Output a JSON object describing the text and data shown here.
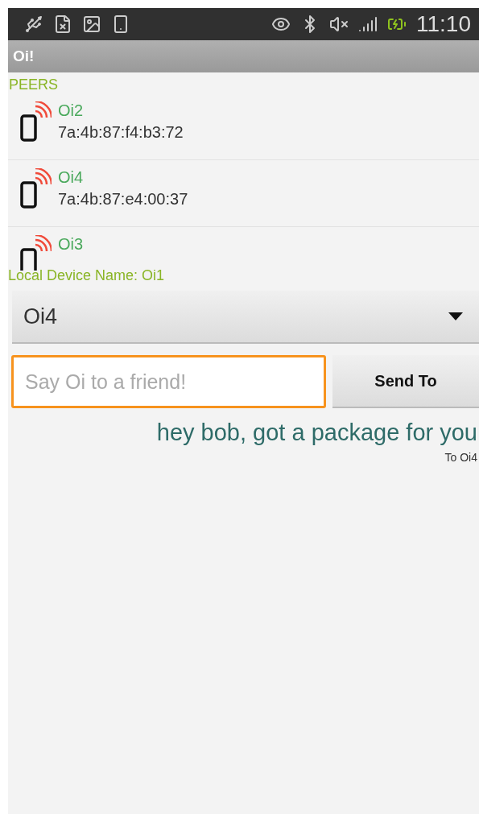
{
  "status_bar": {
    "time": "11:10"
  },
  "app_bar": {
    "title": "Oi!"
  },
  "peers_header": "PEERS",
  "peers": [
    {
      "name": "Oi2",
      "address": "7a:4b:87:f4:b3:72"
    },
    {
      "name": "Oi4",
      "address": "7a:4b:87:e4:00:37"
    },
    {
      "name": "Oi3"
    }
  ],
  "local_device": "Local Device Name: Oi1",
  "recipient_dropdown": {
    "value": "Oi4"
  },
  "message_field": {
    "placeholder": "Say Oi to a friend!",
    "focused": true
  },
  "send_button": "Send To",
  "messages": [
    {
      "text": "hey bob, got a package for you",
      "recipient": "To Oi4"
    }
  ]
}
